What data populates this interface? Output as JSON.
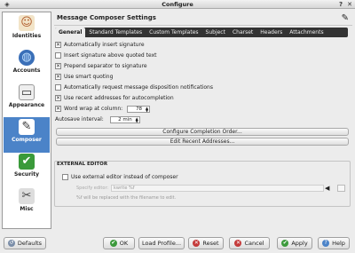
{
  "window": {
    "title": "Configure"
  },
  "sidebar": {
    "items": [
      {
        "label": "Identities",
        "icon": "identities-icon"
      },
      {
        "label": "Accounts",
        "icon": "globe-icon"
      },
      {
        "label": "Appearance",
        "icon": "appearance-icon"
      },
      {
        "label": "Composer",
        "icon": "pen-icon",
        "active": true
      },
      {
        "label": "Security",
        "icon": "shield-icon"
      },
      {
        "label": "Misc",
        "icon": "tools-icon"
      }
    ]
  },
  "header": {
    "title": "Message Composer Settings"
  },
  "tabs": [
    "General",
    "Standard Templates",
    "Custom Templates",
    "Subject",
    "Charset",
    "Headers",
    "Attachments"
  ],
  "options": [
    {
      "label": "Automatically insert signature",
      "checked": true
    },
    {
      "label": "Insert signature above quoted text",
      "checked": false
    },
    {
      "label": "Prepend separator to signature",
      "checked": true
    },
    {
      "label": "Use smart quoting",
      "checked": true
    },
    {
      "label": "Automatically request message disposition notifications",
      "checked": false
    },
    {
      "label": "Use recent addresses for autocompletion",
      "checked": true
    },
    {
      "label": "Word wrap at column:",
      "checked": true
    }
  ],
  "word_wrap_value": "78",
  "autosave": {
    "label": "Autosave interval:",
    "value": "2 min"
  },
  "buttons": {
    "configure_completion": "Configure Completion Order...",
    "edit_recent": "Edit Recent Addresses..."
  },
  "external_editor": {
    "group_title": "EXTERNAL EDITOR",
    "checkbox_label": "Use external editor instead of composer",
    "specify_label": "Specify editor:",
    "editor_value": "kwrite %f",
    "hint": "%f will be replaced with the filename to edit."
  },
  "bottom_bar": {
    "defaults": "Defaults",
    "ok": "OK",
    "load_profile": "Load Profile...",
    "reset": "Reset",
    "cancel": "Cancel",
    "apply": "Apply",
    "help": "Help"
  },
  "colors": {
    "accent": "#4b83c8",
    "ok_green": "#3c9a3c",
    "cancel_red": "#c43a3a"
  }
}
